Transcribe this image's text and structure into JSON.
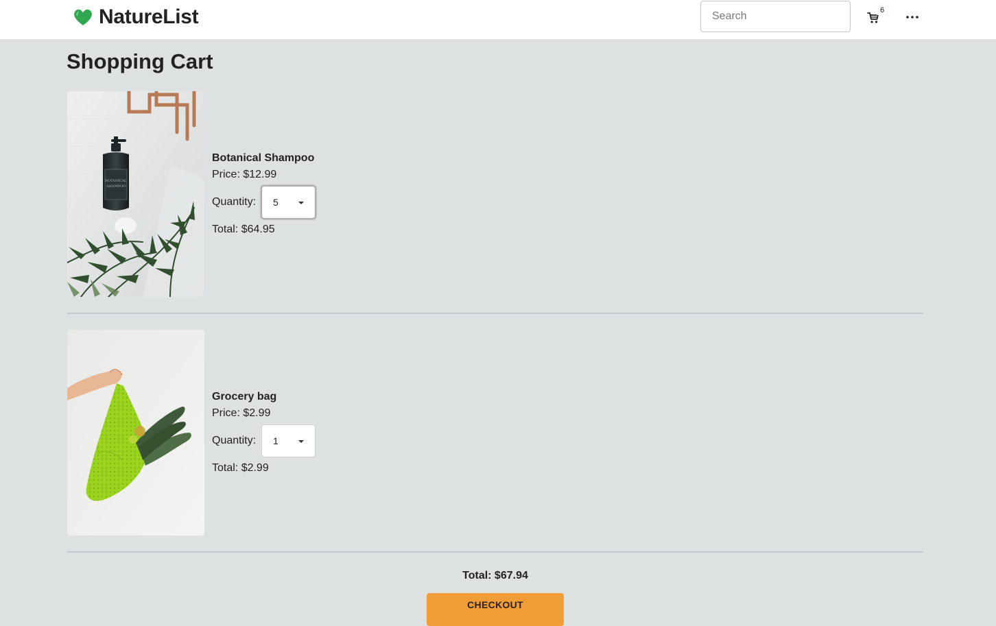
{
  "header": {
    "brand_name": "NatureList",
    "brand_icon": "green-heart-icon",
    "search_placeholder": "Search",
    "cart_count": "6"
  },
  "page_title": "Shopping Cart",
  "items": [
    {
      "name": "Botanical Shampoo",
      "price_label": "Price: $12.99",
      "quantity_label": "Quantity:",
      "quantity": "5",
      "total_label": "Total: $64.95",
      "image": "shampoo-bottle-photo"
    },
    {
      "name": "Grocery bag",
      "price_label": "Price: $2.99",
      "quantity_label": "Quantity:",
      "quantity": "1",
      "total_label": "Total: $2.99",
      "image": "mesh-grocery-bag-photo"
    }
  ],
  "grand_total_label": "Total: $67.94",
  "checkout_label": "CHECKOUT",
  "colors": {
    "page_background": "#dee1e2",
    "checkout_button": "#f09d38",
    "brand_heart": "#2fa84f"
  }
}
